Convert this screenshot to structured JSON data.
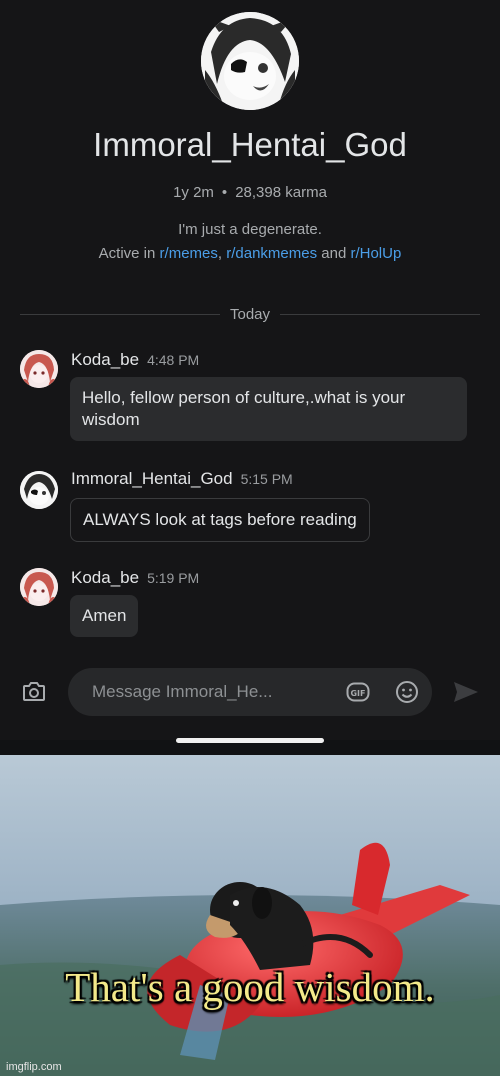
{
  "profile": {
    "username": "Immoral_Hentai_God",
    "account_age": "1y 2m",
    "karma": "28,398 karma",
    "bio": "I'm just a degenerate.",
    "active_prefix": "Active in",
    "communities": [
      "r/memes",
      "r/dankmemes",
      "r/HolUp"
    ],
    "separator": ",",
    "and_word": "and"
  },
  "divider": {
    "label": "Today"
  },
  "messages": [
    {
      "author": "Koda_be",
      "time": "4:48 PM",
      "text": "Hello, fellow person of culture,.what is your wisdom"
    },
    {
      "author": "Immoral_Hentai_God",
      "time": "5:15 PM",
      "text": "ALWAYS look at tags before reading"
    },
    {
      "author": "Koda_be",
      "time": "5:19 PM",
      "text": "Amen"
    }
  ],
  "composer": {
    "placeholder": "Message Immoral_He...",
    "icons": [
      "camera-icon",
      "gif-icon",
      "emoji-icon",
      "send-icon"
    ]
  },
  "meme": {
    "caption": "That's a good wisdom.",
    "watermark": "imgflip.com"
  },
  "colors": {
    "background": "#151517",
    "bubble": "#2b2c2e",
    "link": "#4b9ee8",
    "caption": "#f3e98a"
  }
}
